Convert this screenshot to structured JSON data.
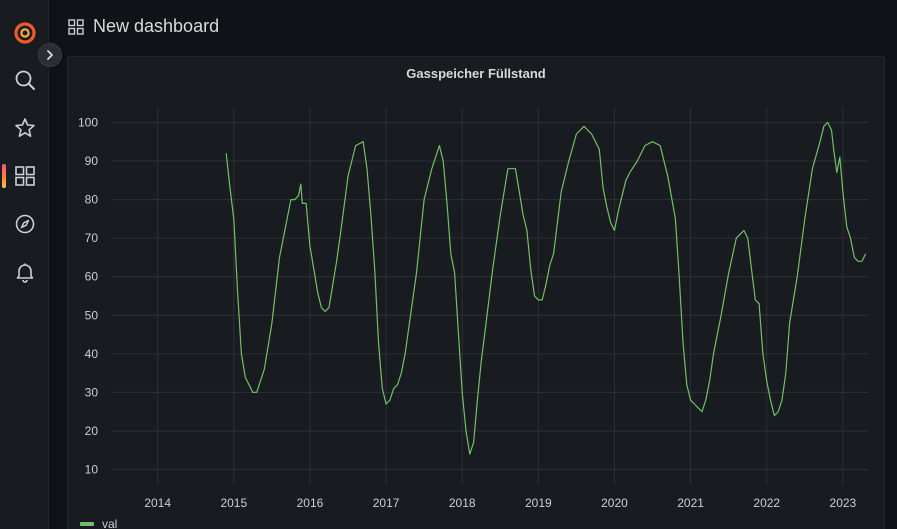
{
  "dashboard": {
    "title": "New dashboard"
  },
  "sidebar": {
    "items": [
      {
        "name": "logo",
        "icon": "grafana-logo-icon"
      },
      {
        "name": "search",
        "icon": "search-icon"
      },
      {
        "name": "starred",
        "icon": "star-icon"
      },
      {
        "name": "dashboards",
        "icon": "apps-grid-icon",
        "active": true
      },
      {
        "name": "explore",
        "icon": "compass-icon"
      },
      {
        "name": "alerting",
        "icon": "bell-icon"
      }
    ],
    "accent": "#f05a28"
  },
  "panel": {
    "title": "Gasspeicher Füllstand"
  },
  "chart_data": {
    "type": "line",
    "title": "Gasspeicher Füllstand",
    "xlabel": "",
    "ylabel": "",
    "xlim": [
      2013.4,
      2023.33
    ],
    "ylim": [
      6,
      104
    ],
    "yticks": [
      10,
      20,
      30,
      40,
      50,
      60,
      70,
      80,
      90,
      100
    ],
    "xticks": [
      "2014",
      "2015",
      "2016",
      "2017",
      "2018",
      "2019",
      "2020",
      "2021",
      "2022",
      "2023"
    ],
    "grid": true,
    "legend": "bottom-left",
    "color": "#73bf69",
    "series": [
      {
        "name": "val",
        "x": [
          2014.9,
          2014.95,
          2015.0,
          2015.05,
          2015.1,
          2015.15,
          2015.2,
          2015.25,
          2015.3,
          2015.4,
          2015.5,
          2015.6,
          2015.7,
          2015.75,
          2015.8,
          2015.85,
          2015.88,
          2015.9,
          2015.95,
          2016.0,
          2016.05,
          2016.1,
          2016.15,
          2016.2,
          2016.25,
          2016.3,
          2016.35,
          2016.4,
          2016.5,
          2016.6,
          2016.7,
          2016.75,
          2016.8,
          2016.85,
          2016.9,
          2016.95,
          2017.0,
          2017.05,
          2017.1,
          2017.15,
          2017.2,
          2017.25,
          2017.3,
          2017.4,
          2017.5,
          2017.6,
          2017.7,
          2017.75,
          2017.8,
          2017.85,
          2017.9,
          2018.0,
          2018.05,
          2018.1,
          2018.15,
          2018.2,
          2018.25,
          2018.3,
          2018.4,
          2018.5,
          2018.6,
          2018.7,
          2018.75,
          2018.8,
          2018.85,
          2018.9,
          2018.95,
          2019.0,
          2019.05,
          2019.1,
          2019.15,
          2019.2,
          2019.3,
          2019.4,
          2019.5,
          2019.6,
          2019.7,
          2019.8,
          2019.85,
          2019.9,
          2019.95,
          2020.0,
          2020.05,
          2020.1,
          2020.15,
          2020.2,
          2020.3,
          2020.4,
          2020.5,
          2020.6,
          2020.7,
          2020.8,
          2020.85,
          2020.9,
          2020.95,
          2021.0,
          2021.05,
          2021.1,
          2021.15,
          2021.2,
          2021.25,
          2021.3,
          2021.4,
          2021.5,
          2021.6,
          2021.7,
          2021.75,
          2021.8,
          2021.85,
          2021.9,
          2021.95,
          2022.0,
          2022.05,
          2022.1,
          2022.15,
          2022.2,
          2022.25,
          2022.3,
          2022.4,
          2022.5,
          2022.6,
          2022.7,
          2022.75,
          2022.8,
          2022.85,
          2022.88,
          2022.92,
          2022.96,
          2023.0,
          2023.05,
          2023.1,
          2023.15,
          2023.2,
          2023.25,
          2023.3
        ],
        "y": [
          92,
          83,
          75,
          56,
          40,
          34,
          32,
          30,
          30,
          36,
          48,
          65,
          75,
          80,
          80,
          81,
          84,
          79,
          79,
          68,
          62,
          56,
          52,
          51,
          52,
          58,
          64,
          71,
          86,
          94,
          95,
          88,
          76,
          62,
          43,
          31,
          27,
          28,
          31,
          32,
          35,
          40,
          47,
          61,
          80,
          88,
          94,
          90,
          79,
          66,
          61,
          30,
          20,
          14,
          17,
          28,
          38,
          46,
          62,
          76,
          88,
          88,
          82,
          76,
          72,
          62,
          55,
          54,
          54,
          58,
          63,
          66,
          82,
          90,
          97,
          99,
          97,
          93,
          83,
          78,
          74,
          72,
          77,
          81,
          85,
          87,
          90,
          94,
          95,
          94,
          86,
          75,
          60,
          43,
          32,
          28,
          27,
          26,
          25,
          28,
          33,
          40,
          50,
          61,
          70,
          72,
          70,
          62,
          54,
          53,
          40,
          33,
          28,
          24,
          25,
          28,
          35,
          48,
          60,
          75,
          88,
          95,
          99,
          100,
          98,
          93,
          87,
          91,
          82,
          73,
          70,
          65,
          64,
          64,
          66
        ]
      }
    ]
  }
}
